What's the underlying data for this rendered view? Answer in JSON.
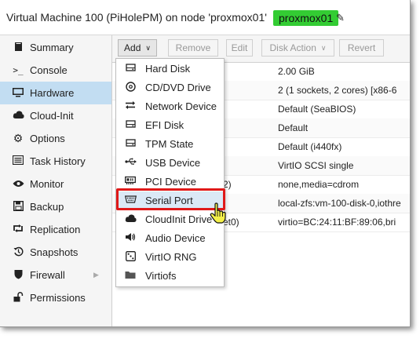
{
  "window": {
    "title": "Virtual Machine 100 (PiHolePM) on node 'proxmox01'",
    "node_badge": "proxmox01",
    "colors": {
      "badge": "#33cc33",
      "active_nav": "#c2ddf2",
      "highlight": "#e01919"
    }
  },
  "sidebar": {
    "items": [
      {
        "label": "Summary",
        "icon": "book-icon"
      },
      {
        "label": "Console",
        "icon": "terminal-icon"
      },
      {
        "label": "Hardware",
        "icon": "monitor-icon",
        "active": true
      },
      {
        "label": "Cloud-Init",
        "icon": "cloud-icon"
      },
      {
        "label": "Options",
        "icon": "gear-icon"
      },
      {
        "label": "Task History",
        "icon": "list-icon"
      },
      {
        "label": "Monitor",
        "icon": "eye-icon"
      },
      {
        "label": "Backup",
        "icon": "floppy-icon"
      },
      {
        "label": "Replication",
        "icon": "retweet-icon"
      },
      {
        "label": "Snapshots",
        "icon": "history-icon"
      },
      {
        "label": "Firewall",
        "icon": "shield-icon"
      },
      {
        "label": "Permissions",
        "icon": "unlock-icon"
      }
    ]
  },
  "toolbar": {
    "add": "Add",
    "remove": "Remove",
    "edit": "Edit",
    "disk_action": "Disk Action",
    "revert": "Revert"
  },
  "hardware_rows": [
    {
      "value": "2.00 GiB"
    },
    {
      "value": "2 (1 sockets, 2 cores) [x86-6"
    },
    {
      "value": "Default (SeaBIOS)"
    },
    {
      "value": "Default"
    },
    {
      "value": "Default (i440fx)"
    },
    {
      "value": "VirtIO SCSI single"
    },
    {
      "key_fragment": "2)",
      "value": "none,media=cdrom"
    },
    {
      "value": "local-zfs:vm-100-disk-0,iothre"
    },
    {
      "key_fragment": "et0)",
      "value": "virtio=BC:24:11:BF:89:06,bri"
    }
  ],
  "add_menu": {
    "items": [
      {
        "label": "Hard Disk",
        "icon": "hdd-icon"
      },
      {
        "label": "CD/DVD Drive",
        "icon": "disc-icon"
      },
      {
        "label": "Network Device",
        "icon": "exchange-icon"
      },
      {
        "label": "EFI Disk",
        "icon": "hdd-icon"
      },
      {
        "label": "TPM State",
        "icon": "hdd-icon"
      },
      {
        "label": "USB Device",
        "icon": "usb-icon"
      },
      {
        "label": "PCI Device",
        "icon": "pci-card-icon"
      },
      {
        "label": "Serial Port",
        "icon": "serial-port-icon",
        "hovered": true
      },
      {
        "label": "CloudInit Drive",
        "icon": "cloud-icon"
      },
      {
        "label": "Audio Device",
        "icon": "volume-icon"
      },
      {
        "label": "VirtIO RNG",
        "icon": "dice-icon"
      },
      {
        "label": "Virtiofs",
        "icon": "folder-icon"
      }
    ]
  }
}
